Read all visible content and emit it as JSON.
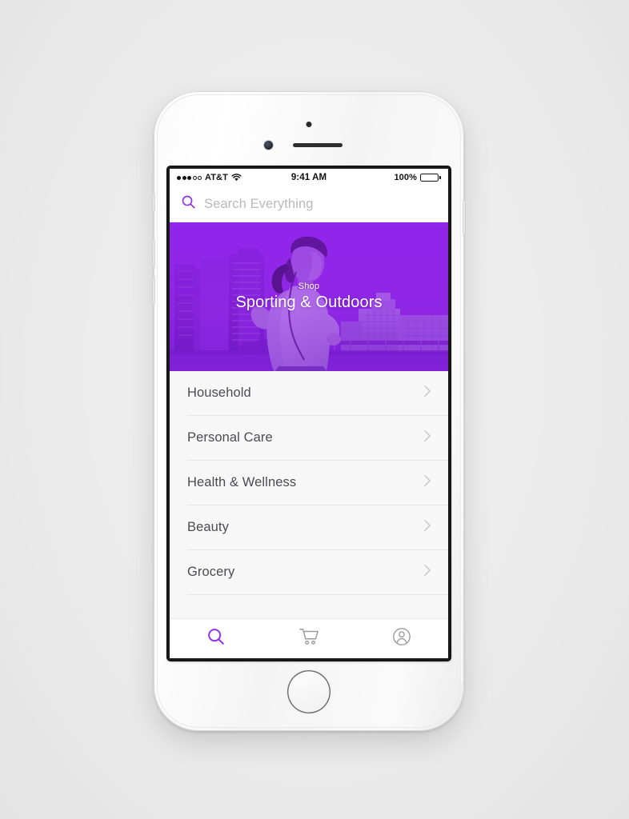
{
  "device": {
    "name": "iphone-white-mockup",
    "body_color": "#f6f6f6",
    "home_button": "home-button"
  },
  "theme": {
    "accent": "#9333EA",
    "hero_purple": "#a93af0",
    "list_bg": "#f7f7f8",
    "divider": "#e6e6e7",
    "text_primary": "#4c4c50",
    "placeholder": "#b9b9bd",
    "chevron": "#c3c3c6",
    "tab_inactive": "#9a9a9e"
  },
  "status_bar": {
    "signal_dots_filled": 3,
    "signal_dots_total": 5,
    "carrier": "AT&T",
    "wifi_icon": "wifi-icon",
    "time": "9:41 AM",
    "battery_percent": "100%",
    "battery_level": 100
  },
  "search": {
    "icon": "search-icon",
    "placeholder": "Search Everything",
    "value": ""
  },
  "hero": {
    "icon": "hero-banner-image",
    "kicker": "Shop",
    "title": "Sporting & Outdoors",
    "image_description": "woman jogging in city, purple duotone"
  },
  "categories": [
    {
      "label": "Household",
      "chevron": "chevron-right-icon"
    },
    {
      "label": "Personal Care",
      "chevron": "chevron-right-icon"
    },
    {
      "label": "Health & Wellness",
      "chevron": "chevron-right-icon"
    },
    {
      "label": "Beauty",
      "chevron": "chevron-right-icon"
    },
    {
      "label": "Grocery",
      "chevron": "chevron-right-icon"
    }
  ],
  "tab_bar": {
    "items": [
      {
        "name": "tab-search",
        "icon": "search-icon",
        "active": true
      },
      {
        "name": "tab-cart",
        "icon": "shopping-cart-icon",
        "active": false
      },
      {
        "name": "tab-account",
        "icon": "account-circle-icon",
        "active": false
      }
    ]
  }
}
